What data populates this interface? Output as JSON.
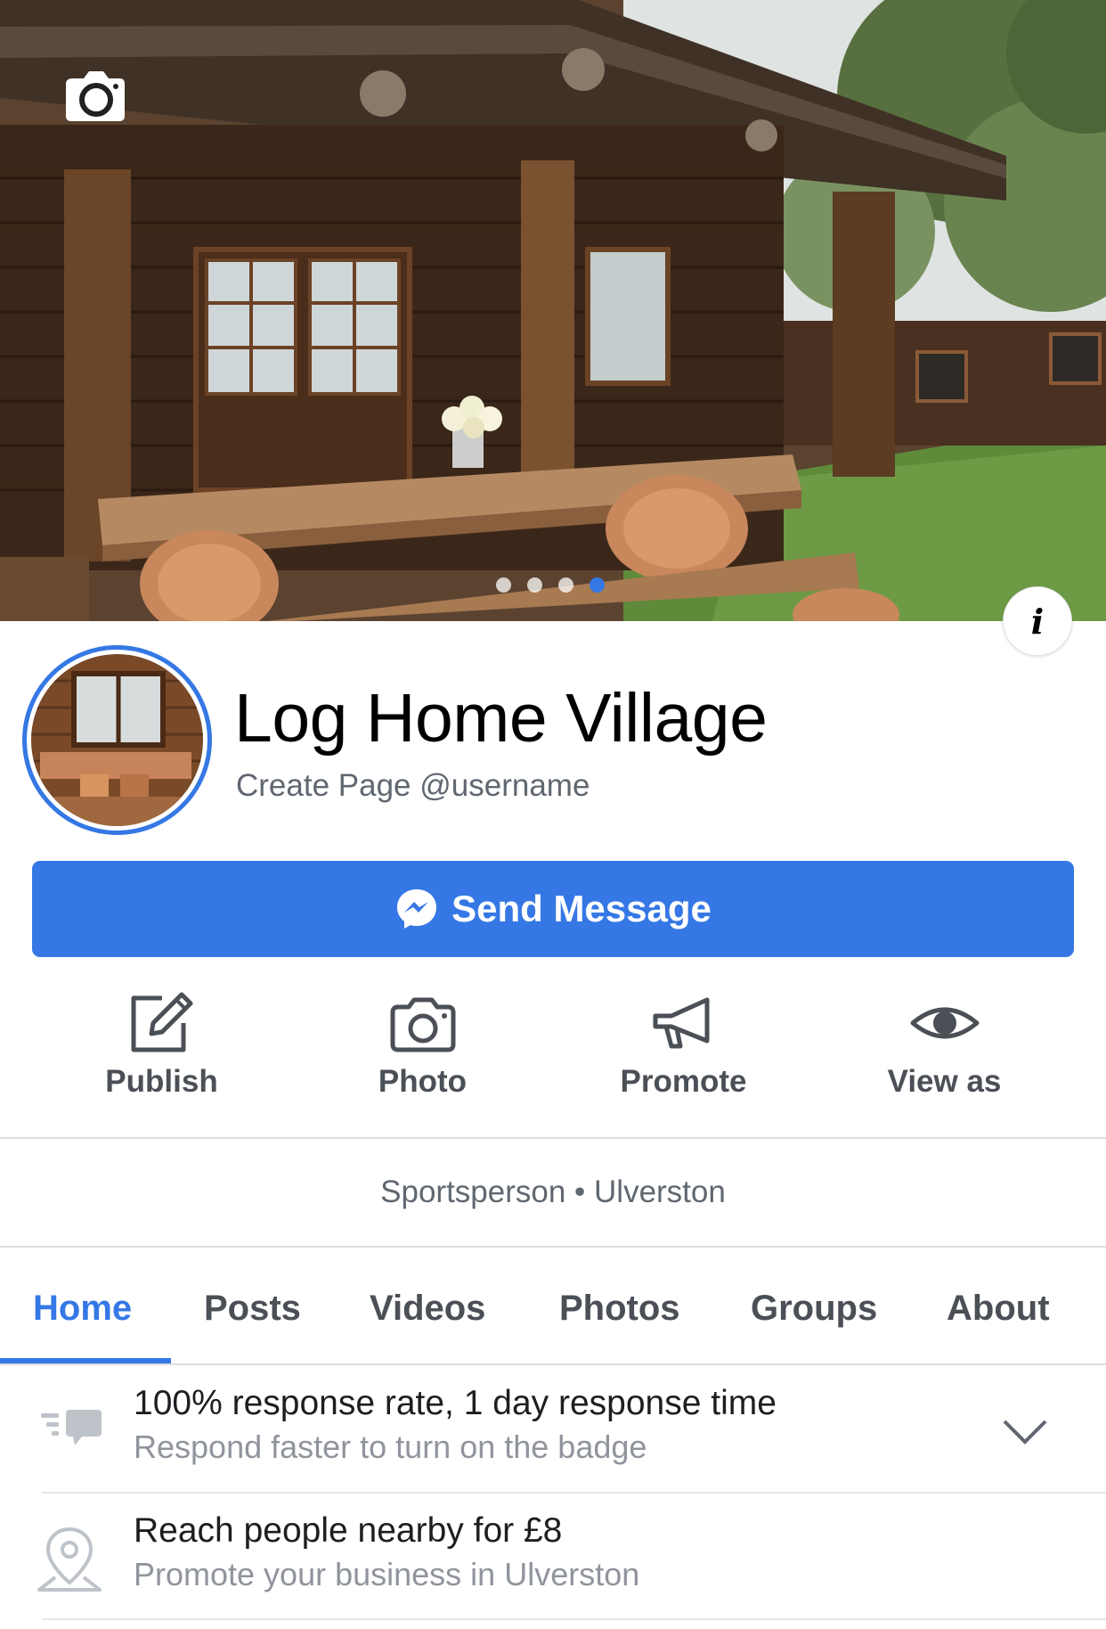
{
  "cover": {
    "slide_count": 4,
    "active_slide": 4
  },
  "page": {
    "name": "Log Home Village",
    "username_prompt": "Create Page @username"
  },
  "primary_action": {
    "label": "Send Message"
  },
  "actions": [
    {
      "label": "Publish",
      "icon": "edit-icon"
    },
    {
      "label": "Photo",
      "icon": "camera-icon"
    },
    {
      "label": "Promote",
      "icon": "megaphone-icon"
    },
    {
      "label": "View as",
      "icon": "eye-icon"
    }
  ],
  "category_line": "Sportsperson • Ulverston",
  "tabs": [
    {
      "label": "Home",
      "active": true
    },
    {
      "label": "Posts"
    },
    {
      "label": "Videos"
    },
    {
      "label": "Photos"
    },
    {
      "label": "Groups"
    },
    {
      "label": "About"
    }
  ],
  "info_rows": [
    {
      "title": "100% response rate, 1 day response time",
      "subtitle": "Respond faster to turn on the badge",
      "icon": "message-response-icon"
    },
    {
      "title": "Reach people nearby for £8",
      "subtitle": "Promote your business in Ulverston",
      "icon": "location-pin-icon"
    }
  ],
  "colors": {
    "accent": "#3578e5",
    "muted_text": "#606770",
    "icon_gray": "#4b4f56"
  }
}
